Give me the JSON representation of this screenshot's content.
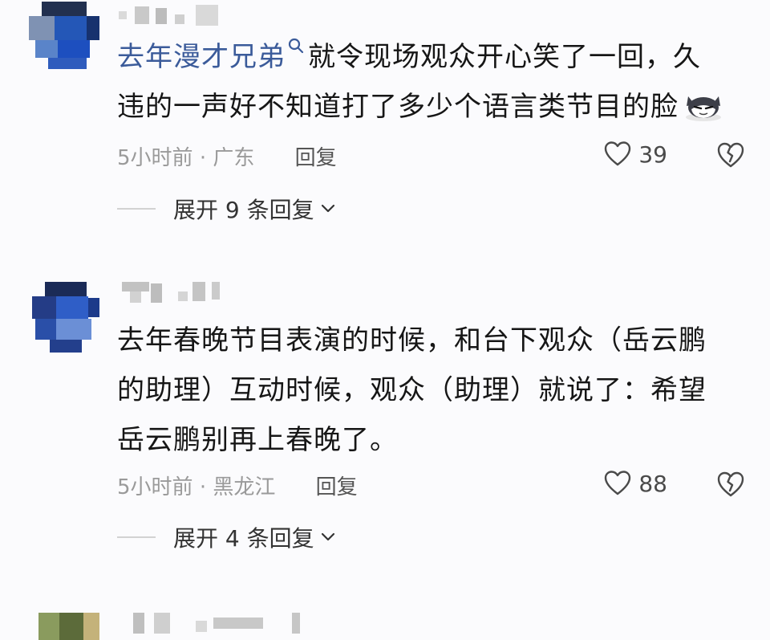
{
  "comments": [
    {
      "body_link": "去年漫才兄弟",
      "body_rest_line1": "就令现场观众开心笑了一回，久",
      "body_line2": "违的一声好不知道打了多少个语言类节目的脸",
      "time": "5小时前",
      "location": "广东",
      "reply_label": "回复",
      "likes": "39",
      "expand_label": "展开 9 条回复",
      "emoji": "cat-emoji"
    },
    {
      "body_line1": "去年春晚节目表演的时候，和台下观众（岳云鹏",
      "body_line2": "的助理）互动时候，观众（助理）就说了：希望",
      "body_line3": "岳云鹏别再上春晚了。",
      "time": "5小时前",
      "location": "黑龙江",
      "reply_label": "回复",
      "likes": "88",
      "expand_label": "展开 4 条回复"
    }
  ],
  "separator": "·",
  "colors": {
    "link": "#3b5b9a",
    "meta": "#9a9a9a",
    "text": "#161616"
  },
  "icons": {
    "like": "heart-outline-icon",
    "dislike": "broken-heart-icon",
    "expand": "chevron-down-icon",
    "search": "search-icon"
  }
}
